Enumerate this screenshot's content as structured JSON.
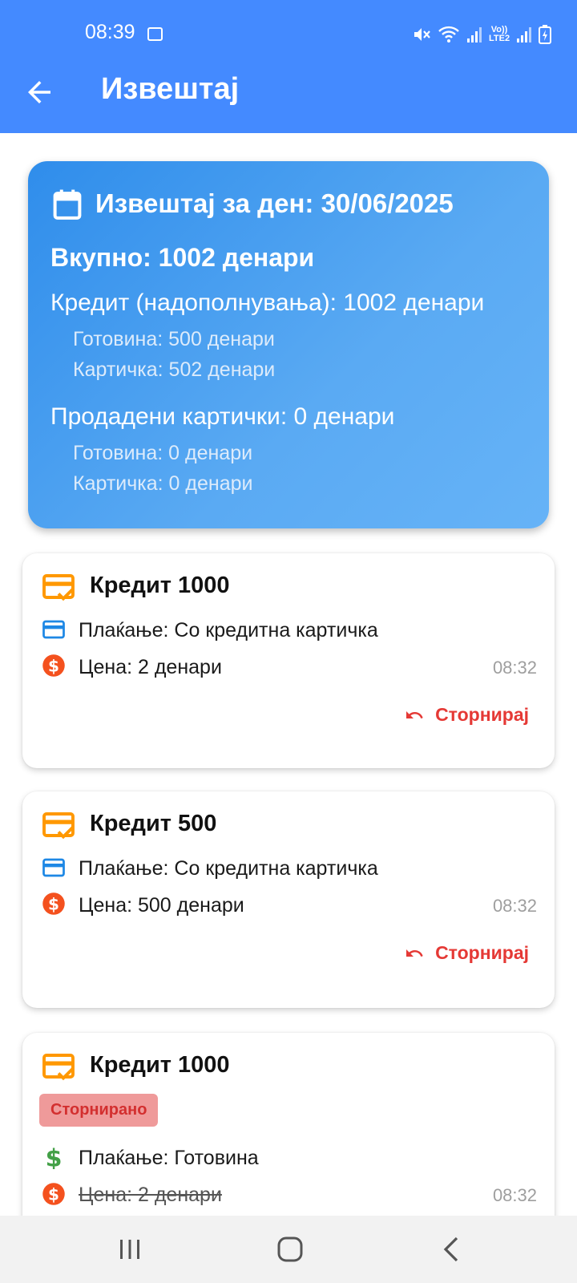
{
  "status_bar": {
    "time": "08:39",
    "volte_label": "Vo)) LTE2",
    "icons": [
      "image-icon",
      "mute-icon",
      "wifi-icon",
      "signal-icon",
      "volte-icon",
      "signal-icon",
      "battery-charging-icon"
    ]
  },
  "header": {
    "title": "Извештај"
  },
  "summary": {
    "title": "Извештај за ден: 30/06/2025",
    "total": "Вкупно: 1002 денари",
    "credit": "Кредит (надополнувања): 1002 денари",
    "credit_cash": "Готовина: 500 денари",
    "credit_card": "Картичка: 502 денари",
    "sold_cards": "Продадени картички: 0 денари",
    "sold_cash": "Готовина: 0 денари",
    "sold_card": "Картичка: 0 денари"
  },
  "transactions": [
    {
      "title": "Кредит 1000",
      "payment": "Плаќање: Со кредитна картичка",
      "price": "Цена: 2 денари",
      "time": "08:32",
      "action": "Сторнирај"
    },
    {
      "title": "Кредит 500",
      "payment": "Плаќање: Со кредитна картичка",
      "price": "Цена: 500 денари",
      "time": "08:32",
      "action": "Сторнирај"
    },
    {
      "title": "Кредит 1000",
      "badge": "Сторнирано",
      "payment": "Плаќање: Готовина",
      "price": "Цена: 2 денари",
      "time": "08:32"
    }
  ],
  "colors": {
    "appbar": "#448AFF",
    "summary_gradient_start": "#2F8DEB",
    "summary_gradient_end": "#66B3F7",
    "card_icon": "#FF9800",
    "storno": "#E53935",
    "badge_bg": "#EF9A9A",
    "price_icon": "#F4511E",
    "payment_card_icon": "#1E88E5",
    "cash_icon": "#43A047"
  }
}
